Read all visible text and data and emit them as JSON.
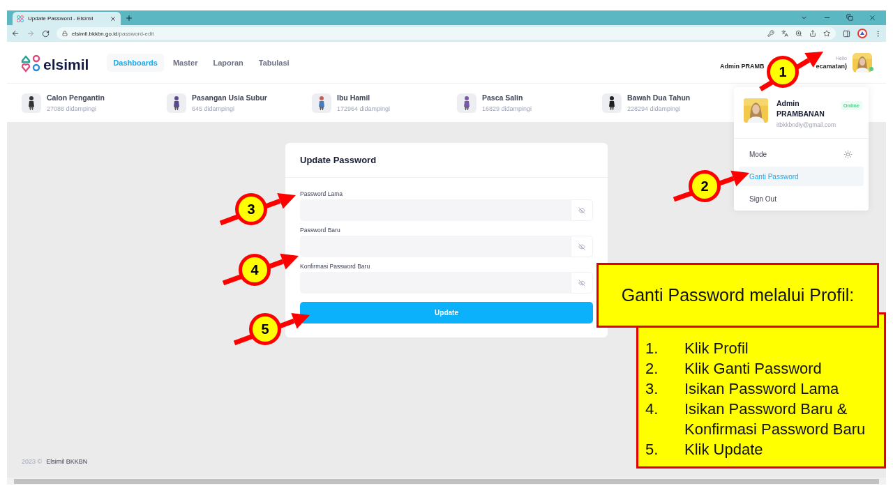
{
  "browser": {
    "tab_title": "Update Password - Elsimil",
    "url_domain": "elsimil.bkkbn.go.id",
    "url_path": "/password-edit"
  },
  "header": {
    "logo": "elsimil",
    "nav": [
      {
        "label": "Dashboards",
        "selected": true
      },
      {
        "label": "Master",
        "selected": false
      },
      {
        "label": "Laporan",
        "selected": false
      },
      {
        "label": "Tabulasi",
        "selected": false
      }
    ],
    "greeting": "Hello",
    "user_name_start": "Admin PRAMB",
    "user_name_end": "ecamatan)"
  },
  "stats": [
    {
      "title": "Calon Pengantin",
      "count": "27088 didampingi"
    },
    {
      "title": "Pasangan Usia Subur",
      "count": "645 didampingi"
    },
    {
      "title": "Ibu Hamil",
      "count": "172964 didampingi"
    },
    {
      "title": "Pasca Salin",
      "count": "16829 didampingi"
    },
    {
      "title": "Bawah Dua Tahun",
      "count": "228294 didampingi"
    }
  ],
  "profile_menu": {
    "name": "Admin PRAMBANAN",
    "status": "Online",
    "email": "itbkkbndiy@gmail.com",
    "items": [
      {
        "kind": "mode",
        "label": "Mode",
        "selected": false
      },
      {
        "kind": "link",
        "label": "Ganti Password",
        "selected": true
      },
      {
        "kind": "link",
        "label": "Sign Out",
        "selected": false
      }
    ]
  },
  "form": {
    "title": "Update Password",
    "fields": [
      {
        "label": "Password Lama"
      },
      {
        "label": "Password Baru"
      },
      {
        "label": "Konfirmasi Password Baru"
      }
    ],
    "submit": "Update"
  },
  "footer": {
    "year": "2023 ©",
    "org": "Elsimil BKKBN"
  },
  "annotations": {
    "markers": [
      "1",
      "2",
      "3",
      "4",
      "5"
    ],
    "callout": {
      "title": "Ganti Password melalui Profil:",
      "steps": [
        {
          "number": "1.",
          "text": "Klik Profil"
        },
        {
          "number": "2.",
          "text": "Klik Ganti Password"
        },
        {
          "number": "3.",
          "text": "Isikan Password Lama"
        },
        {
          "number": "4.",
          "text": "Isikan Password Baru & Konfirmasi Password Baru"
        },
        {
          "number": "5.",
          "text": "Klik Update"
        }
      ]
    }
  }
}
